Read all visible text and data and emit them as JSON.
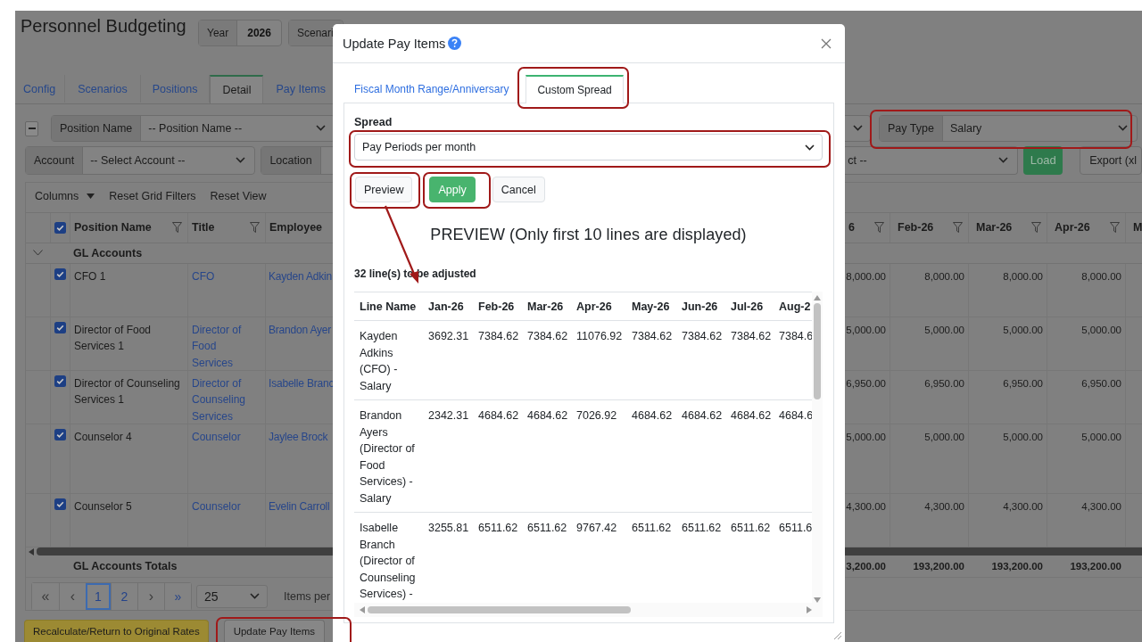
{
  "page": {
    "title": "Personnel Budgeting",
    "header_fields": [
      {
        "label": "Year",
        "value": "2026"
      },
      {
        "label": "Scenari"
      }
    ]
  },
  "tabs": [
    {
      "label": "Config",
      "selected": false
    },
    {
      "label": "Scenarios",
      "selected": false
    },
    {
      "label": "Positions",
      "selected": false
    },
    {
      "label": "Detail",
      "selected": true
    },
    {
      "label": "Pay Items",
      "selected": false
    }
  ],
  "filters": {
    "position_name": {
      "label": "Position Name",
      "placeholder": "-- Position Name --"
    },
    "pay_type": {
      "label": "Pay Type",
      "value": "Salary"
    },
    "account": {
      "label": "Account",
      "placeholder": "-- Select Account --"
    },
    "location": {
      "label": "Location"
    },
    "other_select": {
      "placeholder": "ct --"
    },
    "load_button": "Load",
    "export_button": "Export (xl"
  },
  "grid_toolbar": {
    "columns_menu": "Columns",
    "buttons": [
      "Reset Grid Filters",
      "Reset View"
    ]
  },
  "grid": {
    "all_checked": true,
    "columns": [
      {
        "label": "Position Name",
        "filter": true
      },
      {
        "label": "Title",
        "filter": true
      },
      {
        "label": "Employee",
        "filter": false
      },
      {
        "label": "6",
        "filter": true
      },
      {
        "label": "Feb-26",
        "filter": true
      },
      {
        "label": "Mar-26",
        "filter": true
      },
      {
        "label": "Apr-26",
        "filter": true
      },
      {
        "label": "M",
        "filter": false
      }
    ],
    "group": {
      "label": "GL Accounts",
      "expanded": true
    },
    "rows": [
      {
        "checked": true,
        "position_name": "CFO 1",
        "title": "CFO",
        "employee": "Kayden Adkin",
        "values": [
          "8,000.00",
          "8,000.00",
          "8,000.00",
          "8,000.00"
        ]
      },
      {
        "checked": true,
        "position_name": "Director of Food Services 1",
        "title": "Director of Food Services",
        "employee": "Brandon Ayer",
        "values": [
          "5,000.00",
          "5,000.00",
          "5,000.00",
          "5,000.00"
        ]
      },
      {
        "checked": true,
        "position_name": "Director of Counseling Services 1",
        "title": "Director of Counseling Services",
        "employee": "Isabelle Branc",
        "values": [
          "6,950.00",
          "6,950.00",
          "6,950.00",
          "6,950.00"
        ]
      },
      {
        "checked": true,
        "position_name": "Counselor 4",
        "title": "Counselor",
        "employee": "Jaylee Brock",
        "values": [
          "5,000.00",
          "5,000.00",
          "5,000.00",
          "5,000.00"
        ]
      },
      {
        "checked": true,
        "position_name": "Counselor 5",
        "title": "Counselor",
        "employee": "Evelin Carroll",
        "values": [
          "4,300.00",
          "4,300.00",
          "4,300.00",
          "4,300.00"
        ]
      }
    ],
    "totals": {
      "label": "GL Accounts Totals",
      "values": [
        "3,200.00",
        "193,200.00",
        "193,200.00",
        "193,200.00"
      ]
    }
  },
  "pager": {
    "first": "«",
    "prev": "‹",
    "pages": [
      {
        "label": "1",
        "selected": true
      },
      {
        "label": "2",
        "selected": false
      }
    ],
    "next": "›",
    "last": "»",
    "page_size": "25",
    "page_size_label": "Items per"
  },
  "bottom_buttons": [
    {
      "label": "Recalculate/Return to Original Rates",
      "kind": "warning"
    },
    {
      "label": "Update Pay Items",
      "kind": "default"
    }
  ],
  "modal": {
    "title": "Update Pay Items",
    "tabs": [
      {
        "label": "Fiscal Month Range/Anniversary",
        "selected": false
      },
      {
        "label": "Custom Spread",
        "selected": true
      }
    ],
    "spread": {
      "label": "Spread",
      "value": "Pay Periods per month"
    },
    "buttons": [
      {
        "label": "Preview",
        "kind": "default"
      },
      {
        "label": "Apply",
        "kind": "primary"
      },
      {
        "label": "Cancel",
        "kind": "default"
      }
    ],
    "preview_heading": "PREVIEW (Only first 10 lines are displayed)",
    "line_count": "32 line(s) to be adjusted",
    "table": {
      "columns": [
        "Line Name",
        "Jan-26",
        "Feb-26",
        "Mar-26",
        "Apr-26",
        "May-26",
        "Jun-26",
        "Jul-26",
        "Aug-2"
      ],
      "rows": [
        {
          "name": "Kayden Adkins (CFO) - Salary",
          "values": [
            "3692.31",
            "7384.62",
            "7384.62",
            "11076.92",
            "7384.62",
            "7384.62",
            "7384.62",
            "7384.6"
          ]
        },
        {
          "name": "Brandon Ayers (Director of Food Services) - Salary",
          "values": [
            "2342.31",
            "4684.62",
            "4684.62",
            "7026.92",
            "4684.62",
            "4684.62",
            "4684.62",
            "4684.6"
          ]
        },
        {
          "name": "Isabelle Branch (Director of Counseling Services) -",
          "values": [
            "3255.81",
            "6511.62",
            "6511.62",
            "9767.42",
            "6511.62",
            "6511.62",
            "6511.62",
            "6511.6"
          ]
        }
      ]
    }
  }
}
